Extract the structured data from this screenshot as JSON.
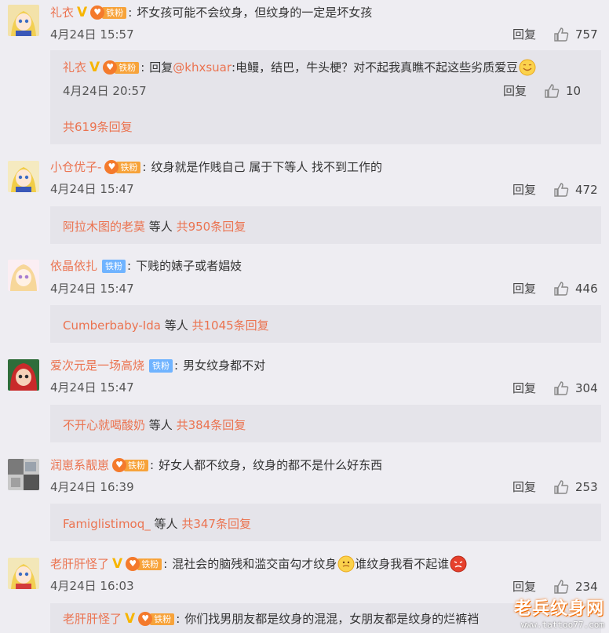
{
  "comments": [
    {
      "username": "礼衣",
      "text": "坏女孩可能不会纹身，但纹身的一定是坏女孩",
      "time": "4月24日 15:57",
      "reply": "回复",
      "likes": "757",
      "subreply": {
        "username": "礼衣",
        "prefix": "回复",
        "mention": "@khxsuar",
        "text": ":电鳗，结巴，牛头梗？对不起我真瞧不起这些劣质爱豆",
        "time": "4月24日 20:57",
        "reply": "回复",
        "likes": "10"
      },
      "footer_count": "共619条回复"
    },
    {
      "username": "小仓优子-",
      "text": "纹身就是作贱自己 属于下等人 找不到工作的",
      "time": "4月24日 15:47",
      "reply": "回复",
      "likes": "472",
      "footer_user": "阿拉木图的老莫",
      "footer_etc": "等人",
      "footer_count": "共950条回复"
    },
    {
      "username": "依晶依扎",
      "text": "下贱的婊子或者娼妓",
      "time": "4月24日 15:47",
      "reply": "回复",
      "likes": "446",
      "footer_user": "Cumberbaby-Ida",
      "footer_etc": "等人",
      "footer_count": "共1045条回复"
    },
    {
      "username": "爱次元是一场高烧",
      "text": "男女纹身都不对",
      "time": "4月24日 15:47",
      "reply": "回复",
      "likes": "304",
      "footer_user": "不开心就喝酸奶",
      "footer_etc": "等人",
      "footer_count": "共384条回复"
    },
    {
      "username": "润崽系靓崽",
      "text": "好女人都不纹身，纹身的都不是什么好东西",
      "time": "4月24日 16:39",
      "reply": "回复",
      "likes": "253",
      "footer_user": "Famiglistimoq_",
      "footer_etc": "等人",
      "footer_count": "共347条回复"
    },
    {
      "username": "老肝肝怪了",
      "text_a": "混社会的脑残和滥交亩勾才纹身",
      "text_b": "谁纹身我看不起谁",
      "time": "4月24日 16:03",
      "reply": "回复",
      "likes": "234",
      "subreply": {
        "username": "老肝肝怪了",
        "text": "你们找男朋友都是纹身的混混，女朋友都是纹身的烂裤裆"
      }
    }
  ],
  "badges": {
    "fan_label": "铁粉",
    "vip_mark": "V"
  },
  "watermark": {
    "line1": "老兵纹身网",
    "line2": "www.tattoo77.com"
  },
  "colors": {
    "username": "#eb7350",
    "background": "#eeedf2",
    "subreply_bg": "#e5e4ea"
  }
}
